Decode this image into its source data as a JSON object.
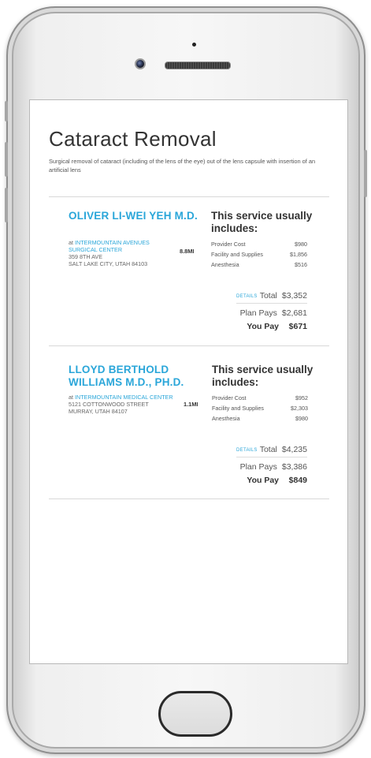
{
  "page": {
    "title": "Cataract Removal",
    "description": "Surgical removal of cataract (including of the lens of the eye) out of the lens capsule with insertion of an artificial lens"
  },
  "colors": {
    "accent": "#2aa6d9",
    "text": "#333333"
  },
  "device": {
    "home_button": "home-button-icon",
    "camera": "camera-icon",
    "speaker": "speaker-icon"
  },
  "providers": [
    {
      "name_line1": "OLIVER LI-WEI YEH M.D.",
      "name_line2": "",
      "at": "at ",
      "facility_line1": "INTERMOUNTAIN AVENUES",
      "facility_line2": "SURGICAL CENTER",
      "address1": "359 8TH AVE",
      "address2": "SALT LAKE CITY, UTAH 84103",
      "distance": "8.8MI",
      "service_heading": "This service usually includes:",
      "costs": [
        {
          "label": "Provider Cost",
          "value": "$980"
        },
        {
          "label": "Facility and Supplies",
          "value": "$1,856"
        },
        {
          "label": "Anesthesia",
          "value": "$516"
        }
      ],
      "details_label": "DETAILS",
      "total_label": "Total",
      "total": "$3,352",
      "plan_label": "Plan Pays",
      "plan_pays": "$2,681",
      "you_label": "You Pay",
      "you_pay": "$671"
    },
    {
      "name_line1": "LLOYD BERTHOLD",
      "name_line2": "WILLIAMS M.D., PH.D.",
      "at": "at ",
      "facility_line1": "INTERMOUNTAIN MEDICAL CENTER",
      "facility_line2": "",
      "address1": "5121 COTTONWOOD STREET",
      "address2": "MURRAY, UTAH 84107",
      "distance": "1.1MI",
      "service_heading": "This service usually includes:",
      "costs": [
        {
          "label": "Provider Cost",
          "value": "$952"
        },
        {
          "label": "Facility and Supplies",
          "value": "$2,303"
        },
        {
          "label": "Anesthesia",
          "value": "$980"
        }
      ],
      "details_label": "DETAILS",
      "total_label": "Total",
      "total": "$4,235",
      "plan_label": "Plan Pays",
      "plan_pays": "$3,386",
      "you_label": "You Pay",
      "you_pay": "$849"
    }
  ]
}
